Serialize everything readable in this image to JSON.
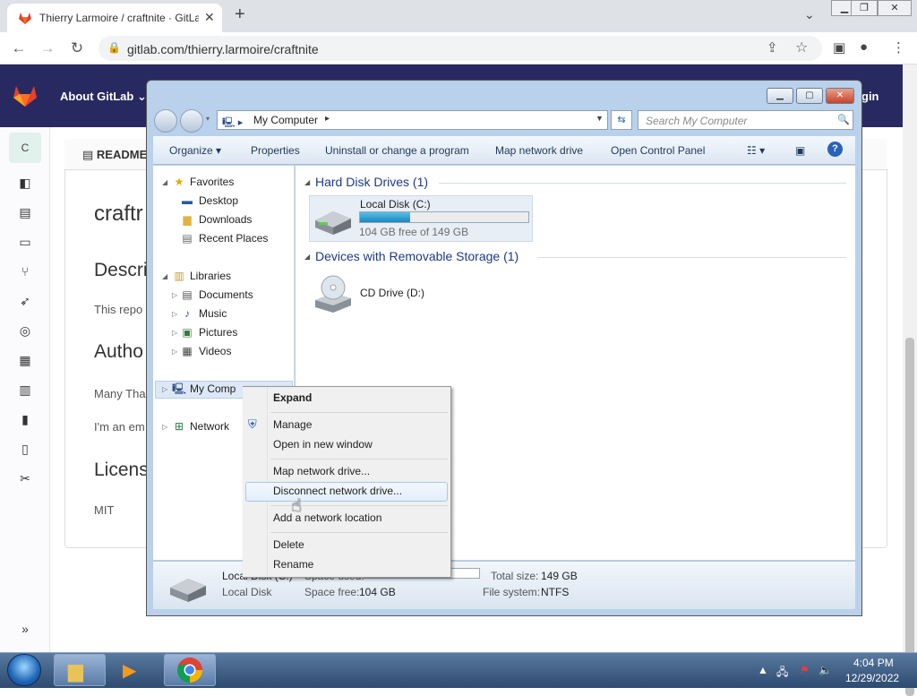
{
  "browser": {
    "tab_title": "Thierry Larmoire / craftnite · GitLab",
    "url": "gitlab.com/thierry.larmoire/craftnite",
    "colors": {
      "tabstrip": "#dee1e6",
      "omnibox": "#f1f3f4"
    }
  },
  "gitlab": {
    "nav_about": "About GitLab",
    "nav_login": "gin",
    "avatar_letter": "C",
    "readme_label": "README",
    "heading": "craftr",
    "description_heading": "Descri",
    "description_text": "This repo",
    "authors_heading": "Autho",
    "authors_line1": "Many Tha",
    "authors_line2": "I'm an em",
    "license_heading": "Licens",
    "license_text": "MIT",
    "colors": {
      "topbar": "#292961"
    },
    "sidebar_icons": [
      "project-icon",
      "repository-icon",
      "issues-icon",
      "merge-request-icon",
      "deploy-icon",
      "monitor-icon",
      "packages-icon",
      "analytics-icon",
      "chart-icon",
      "wiki-icon",
      "snippets-icon"
    ]
  },
  "explorer": {
    "address": "My Computer",
    "search_placeholder": "Search My Computer",
    "commands": [
      "Organize",
      "Properties",
      "Uninstall or change a program",
      "Map network drive",
      "Open Control Panel"
    ],
    "nav": {
      "favorites": "Favorites",
      "desktop": "Desktop",
      "downloads": "Downloads",
      "recent": "Recent Places",
      "libraries": "Libraries",
      "documents": "Documents",
      "music": "Music",
      "pictures": "Pictures",
      "videos": "Videos",
      "mycomputer": "My Comp",
      "network": "Network"
    },
    "group_hdd": "Hard Disk Drives (1)",
    "group_removable": "Devices with Removable Storage (1)",
    "drive_c_name": "Local Disk (C:)",
    "drive_c_free": "104 GB free of 149 GB",
    "drive_c_used_fraction": 0.3,
    "drive_d_name": "CD Drive (D:)",
    "details": {
      "name": "Local Disk (C:)",
      "type": "Local Disk",
      "space_used_label": "Space used:",
      "space_free_label": "Space free:",
      "space_free_value": "104 GB",
      "total_label": "Total size:",
      "total_value": "149 GB",
      "fs_label": "File system:",
      "fs_value": "NTFS"
    },
    "colors": {
      "frame": "#b9d1ea",
      "group_title": "#1e3a87"
    }
  },
  "context_menu": {
    "expand": "Expand",
    "manage": "Manage",
    "open_new_window": "Open in new window",
    "map_drive": "Map network drive...",
    "disconnect_drive": "Disconnect network drive...",
    "add_location": "Add a network location",
    "delete": "Delete",
    "rename": "Rename"
  },
  "taskbar": {
    "time": "4:04 PM",
    "date": "12/29/2022"
  }
}
